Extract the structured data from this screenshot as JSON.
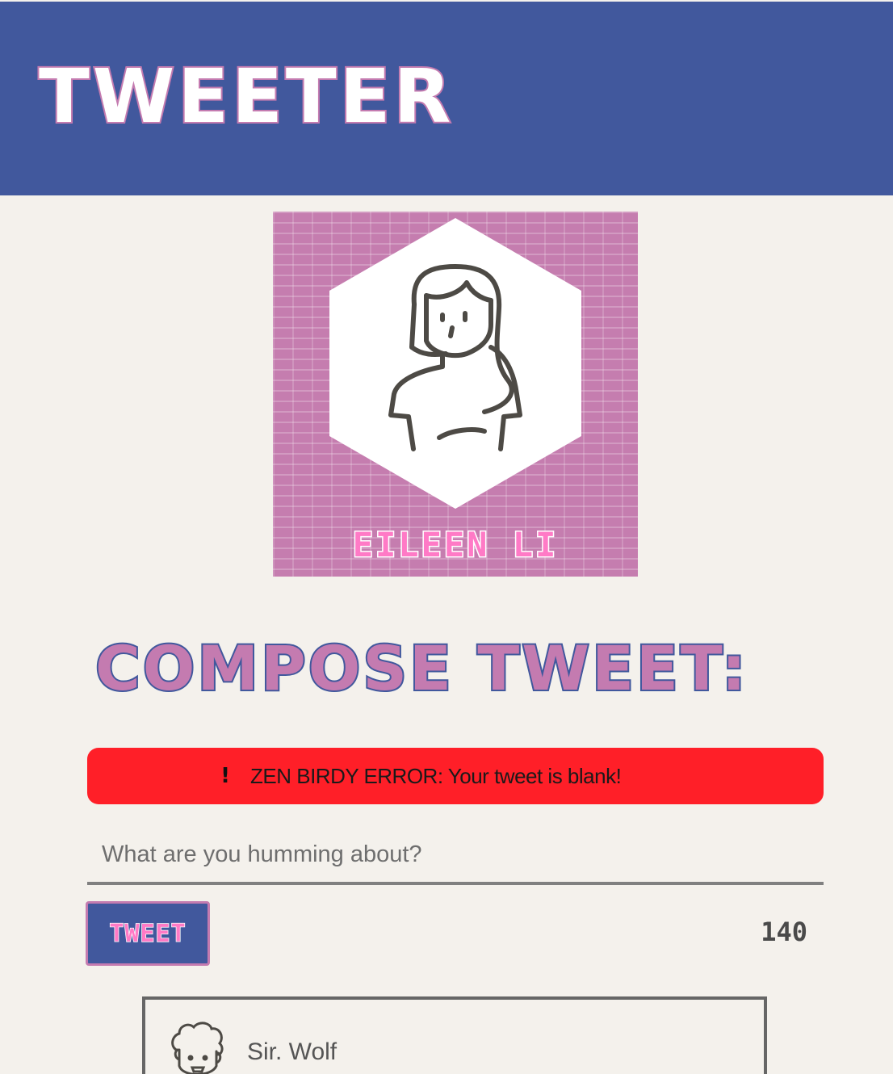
{
  "header": {
    "brand": "TWEETER"
  },
  "profile": {
    "name": "EILEEN LI"
  },
  "compose": {
    "title": "COMPOSE TWEET:",
    "error_icon": "!",
    "error_message": "ZEN BIRDY ERROR: Your tweet is blank!",
    "placeholder": "What are you humming about?",
    "submit_label": "TWEET",
    "counter": "140"
  },
  "tweets": [
    {
      "author": "Sir. Wolf",
      "avatar_icon": "curly-hair-avatar-icon"
    }
  ],
  "colors": {
    "header_bg": "#41589d",
    "accent_pink": "#c47bb0",
    "bright_pink": "#ff7ac6",
    "error_red": "#ff1f28",
    "page_bg": "#f4f1ec"
  }
}
